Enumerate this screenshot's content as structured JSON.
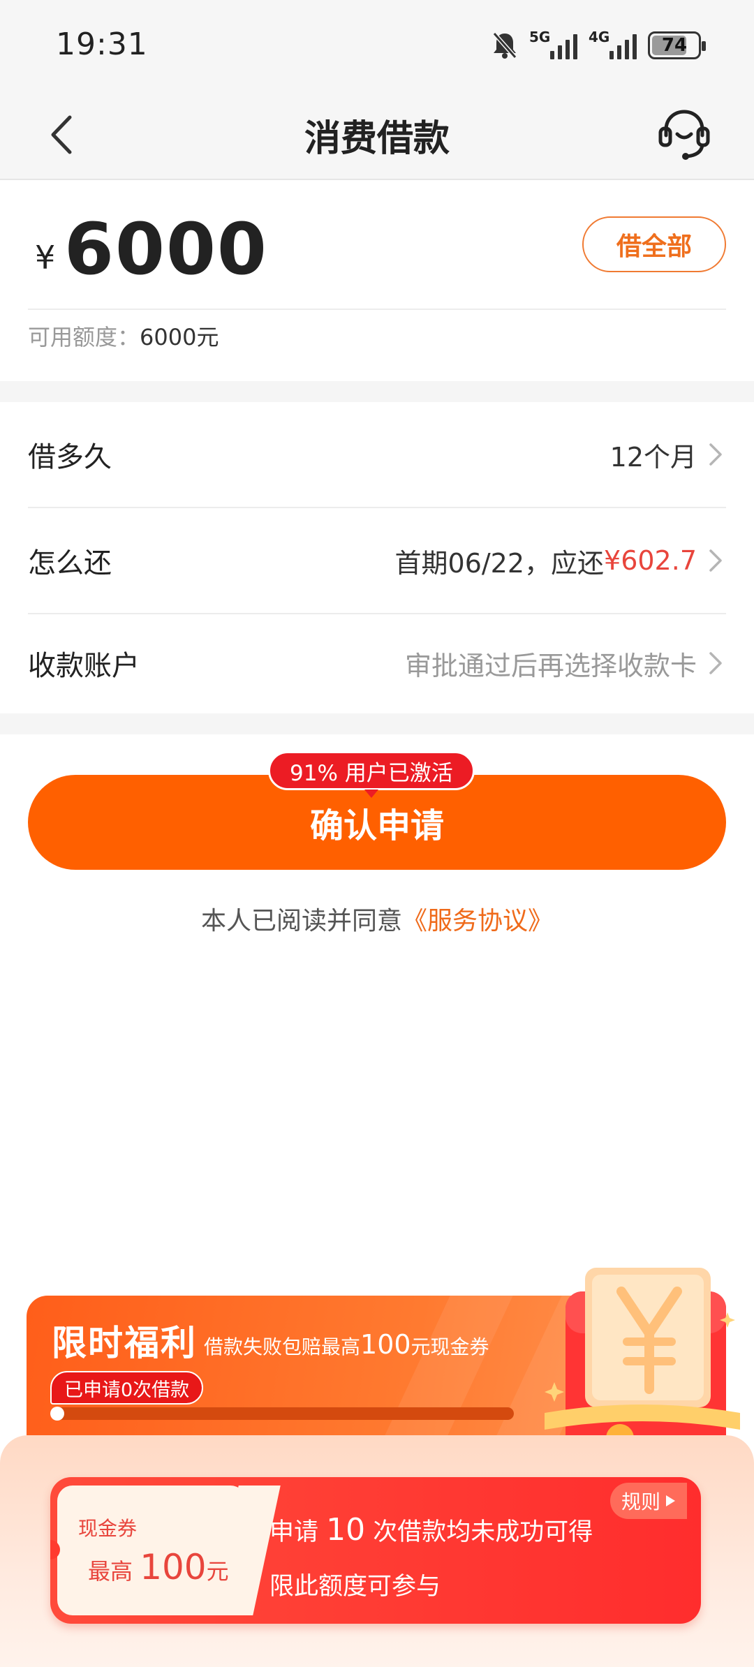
{
  "status_bar": {
    "time": "19:31",
    "sim1": "5G",
    "sim2": "4G",
    "battery": "74"
  },
  "nav": {
    "title": "消费借款"
  },
  "amount": {
    "currency": "¥",
    "value": "6000",
    "borrow_all_label": "借全部",
    "available_label": "可用额度：",
    "available_value": "6000元"
  },
  "options": [
    {
      "label": "借多久",
      "value": "12个月"
    },
    {
      "label": "怎么还",
      "value_prefix": "首期06/22，应还",
      "value_amount": "¥602.7"
    },
    {
      "label": "收款账户",
      "value": "审批通过后再选择收款卡"
    }
  ],
  "confirm": {
    "badge": "91% 用户已激活",
    "label": "确认申请"
  },
  "agreement": {
    "text": "本人已阅读并同意",
    "link": "《服务协议》"
  },
  "promo": {
    "title": "限时福利",
    "subtitle_prefix": "借款失败包赔最高",
    "subtitle_amount": "100",
    "subtitle_suffix": "元现金券",
    "applied_tag": "已申请0次借款",
    "progress": 0
  },
  "coupon": {
    "type": "现金券",
    "max_prefix": "最高",
    "max_amount": "100",
    "max_unit": "元",
    "line1_prefix": "申请",
    "line1_count": "10",
    "line1_suffix": "次借款均未成功可得",
    "line2": "限此额度可参与",
    "rules_label": "规则"
  },
  "colors": {
    "accent": "#ff6000",
    "red": "#e8453c",
    "badge": "#ec1c24"
  },
  "icons": [
    "back-arrow-icon",
    "headset-icon",
    "mute-bell-icon",
    "chevron-right-icon",
    "play-triangle-icon",
    "yen-icon"
  ]
}
